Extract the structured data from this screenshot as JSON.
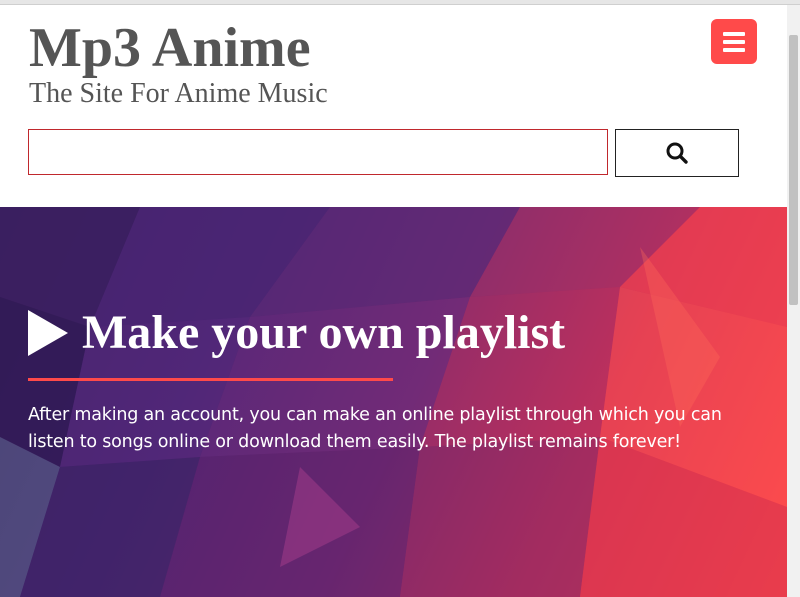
{
  "header": {
    "site_title": "Mp3 Anime",
    "tagline": "The Site For Anime Music",
    "menu_icon": "hamburger-icon",
    "search": {
      "value": "",
      "placeholder": "",
      "button_icon": "search-icon"
    }
  },
  "hero": {
    "play_icon": "play-icon",
    "title": "Make your own playlist",
    "description": "After making an account, you can make an online playlist through which you can listen to songs online or download them easily. The playlist remains forever!"
  },
  "colors": {
    "accent": "#ff4a4a",
    "title_text": "#555555",
    "search_border": "#c0282d",
    "hero_dark": "#3a1e5c",
    "hero_light": "#ff4848"
  }
}
